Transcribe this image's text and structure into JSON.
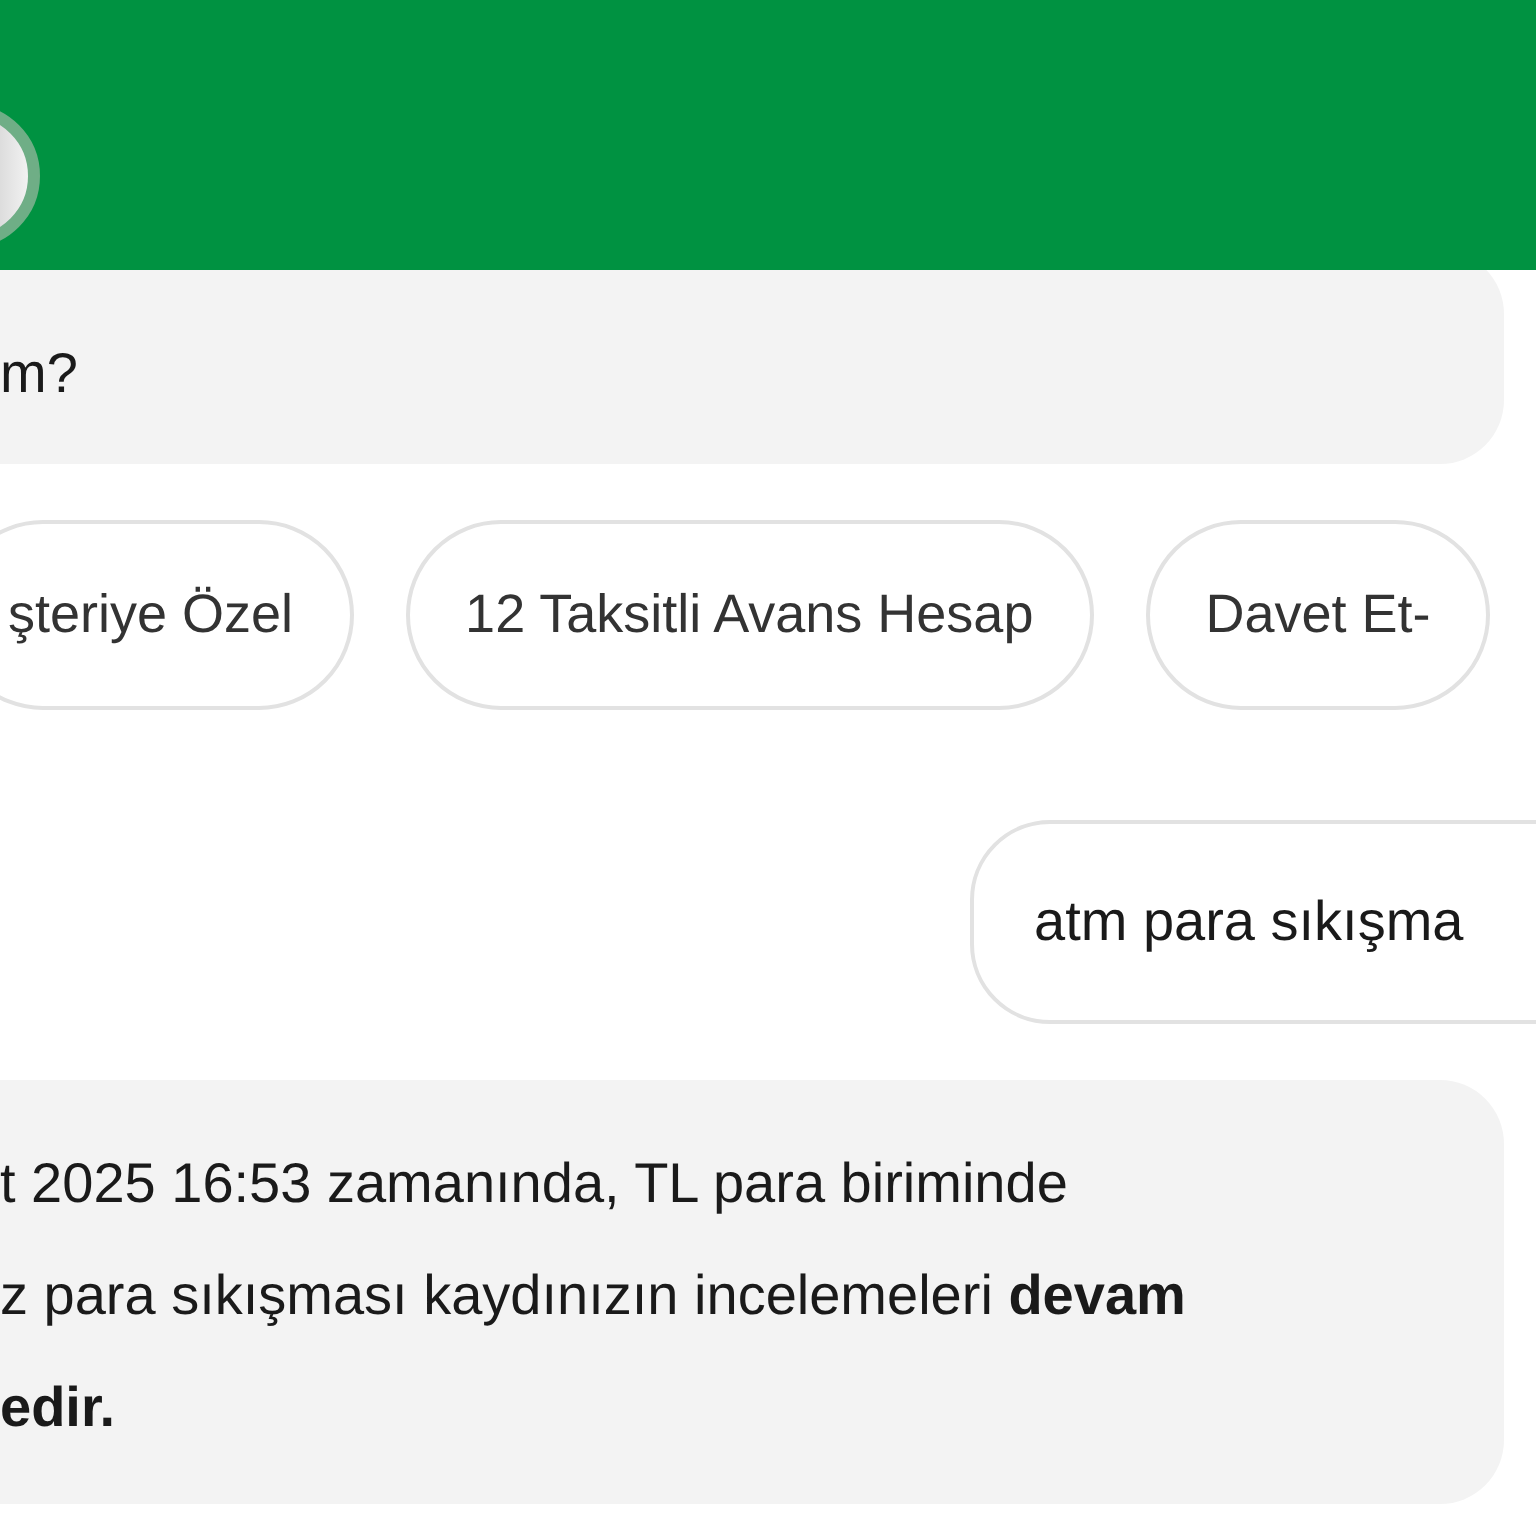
{
  "messages": [
    {
      "kind": "bot",
      "lines": [
        "m?"
      ]
    },
    {
      "kind": "chips",
      "chips": [
        "şteriye Özel",
        "12 Taksitli Avans Hesap",
        "Davet Et-"
      ]
    },
    {
      "kind": "user",
      "lines": [
        "atm para sıkışma"
      ]
    },
    {
      "kind": "bot",
      "lines": [
        "t 2025 16:53 zamanında, TL para biriminde",
        "z para sıkışması kaydınızın incelemeleri **devam**",
        "**edir.**"
      ]
    }
  ]
}
